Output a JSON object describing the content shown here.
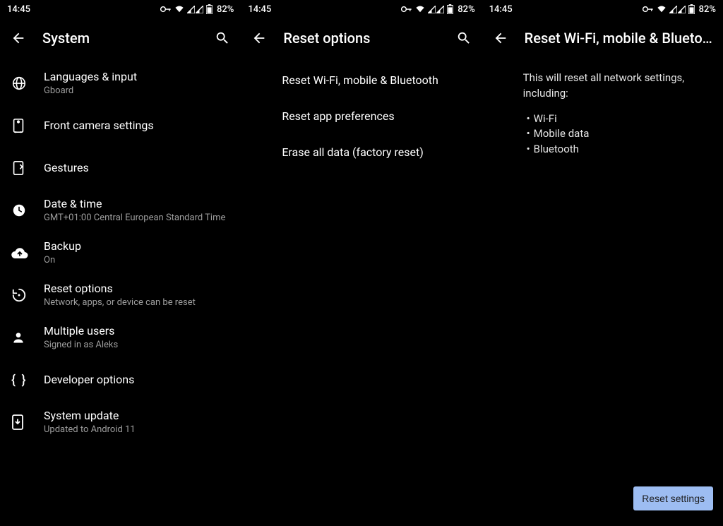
{
  "status": {
    "time": "14:45",
    "battery": "82%"
  },
  "panel1": {
    "title": "System",
    "items": [
      {
        "title": "Languages & input",
        "sub": "Gboard"
      },
      {
        "title": "Front camera settings",
        "sub": ""
      },
      {
        "title": "Gestures",
        "sub": ""
      },
      {
        "title": "Date & time",
        "sub": "GMT+01:00 Central European Standard Time"
      },
      {
        "title": "Backup",
        "sub": "On"
      },
      {
        "title": "Reset options",
        "sub": "Network, apps, or device can be reset"
      },
      {
        "title": "Multiple users",
        "sub": "Signed in as Aleks"
      },
      {
        "title": "Developer options",
        "sub": ""
      },
      {
        "title": "System update",
        "sub": "Updated to Android 11"
      }
    ]
  },
  "panel2": {
    "title": "Reset options",
    "items": [
      "Reset Wi-Fi, mobile & Bluetooth",
      "Reset app preferences",
      "Erase all data (factory reset)"
    ]
  },
  "panel3": {
    "title": "Reset Wi-Fi, mobile & Blueto…",
    "lead": "This will reset all network settings, including:",
    "bullets": [
      "Wi-Fi",
      "Mobile data",
      "Bluetooth"
    ],
    "button": "Reset settings"
  }
}
